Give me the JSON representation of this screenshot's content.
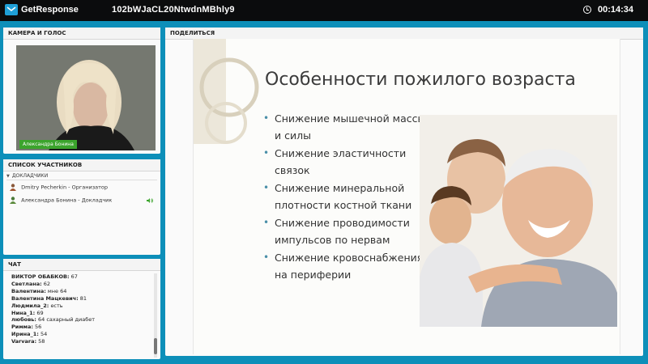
{
  "app": {
    "brand": "GetResponse",
    "room_id": "102bWJaCL20NtwdnMBhly9",
    "timer": "00:14:34"
  },
  "camera": {
    "title": "КАМЕРА И ГОЛОС",
    "presenter_name": "Александра Бонина"
  },
  "participants": {
    "title": "СПИСОК УЧАСТНИКОВ",
    "group": "ДОКЛАДЧИКИ",
    "items": [
      {
        "name": "Dmitry Pecherkin - Организатор"
      },
      {
        "name": "Александра Бонина - Докладчик"
      }
    ]
  },
  "chat": {
    "title": "ЧАТ",
    "messages": [
      {
        "author": "ВИКТОР ОБАБКОВ:",
        "text": "67"
      },
      {
        "author": "Светлана:",
        "text": "62"
      },
      {
        "author": "Валентина:",
        "text": "мне 64"
      },
      {
        "author": "Валентина Мацкевич:",
        "text": "81"
      },
      {
        "author": "Людмила_2:",
        "text": "есть"
      },
      {
        "author": "Нина_1:",
        "text": "69"
      },
      {
        "author": "любовь:",
        "text": "64 сахарный диабет"
      },
      {
        "author": "Римма:",
        "text": "56"
      },
      {
        "author": "Ирина_1:",
        "text": "54"
      },
      {
        "author": "Varvara:",
        "text": "58"
      }
    ]
  },
  "share": {
    "title": "ПОДЕЛИТЬСЯ",
    "slide": {
      "heading": "Особенности пожилого возраста",
      "bullets": [
        "Снижение мышечной массы и силы",
        "Снижение эластичности связок",
        "Снижение минеральной плотности костной ткани",
        "Снижение проводимости импульсов по нервам",
        "Снижение кровоснабжения на периферии"
      ]
    }
  },
  "colors": {
    "background": "#0d8fb9",
    "topbar": "#0b0c0d",
    "accent_green": "#3ba42c"
  }
}
